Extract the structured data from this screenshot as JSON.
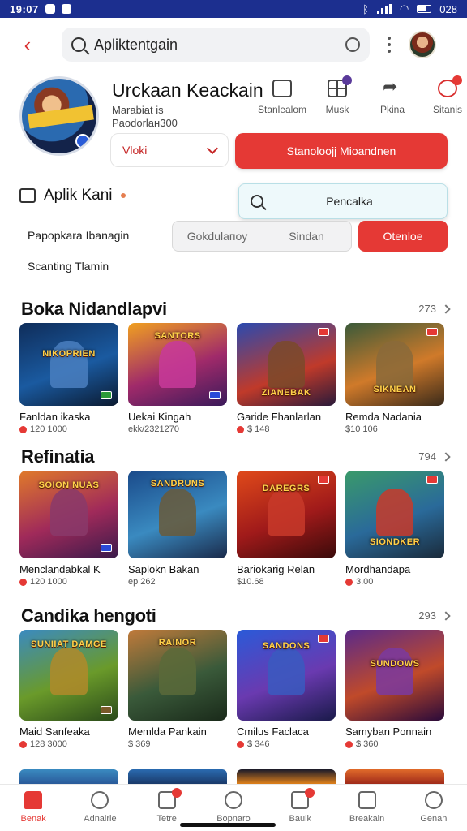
{
  "status_bar": {
    "time": "19:07",
    "battery": "028"
  },
  "topbar": {
    "search_text": "Apliktentgain"
  },
  "profile": {
    "name": "Urckaan Keackain",
    "sub_line1": "Marabiat is",
    "sub_line2": "Paodorlaн300",
    "actions": [
      {
        "label": "Stanlealom",
        "icon": "chat-icon"
      },
      {
        "label": "Musk",
        "icon": "grid-icon"
      },
      {
        "label": "Pkina",
        "icon": "share-icon"
      },
      {
        "label": "Sitanis",
        "icon": "gear-icon"
      }
    ],
    "select_label": "Vloki",
    "primary_button": "Stanoloojj Mioandnen"
  },
  "apk_section": {
    "title": "Aplik Kani",
    "search_text": "Pencalka"
  },
  "filters": {
    "label": "Papopkara Ibanagin",
    "segments": [
      "Gokdulaпоy",
      "Sindan"
    ],
    "active_button": "Otenloe",
    "sub_label": "Scanting Tlamin"
  },
  "sections": [
    {
      "title": "Boka Nidandlapvi",
      "count": "273",
      "cards": [
        {
          "name": "Fanldan ikaska",
          "meta": "120 1000",
          "badge": "",
          "title_art": "NIKOPRIEN"
        },
        {
          "name": "Uekai Kingah",
          "meta": "ekk/2321270",
          "badge": "",
          "title_art": "SANTORS"
        },
        {
          "name": "Garide Fhanlarlan",
          "meta": "$ 148",
          "badge": "",
          "title_art": "ZIANEBAK"
        },
        {
          "name": "Remda Nadania",
          "meta": "$10 106",
          "badge": "",
          "title_art": "SIKNEAN"
        }
      ]
    },
    {
      "title": "Refinatia",
      "count": "794",
      "cards": [
        {
          "name": "Menclandabkal K",
          "meta": "120 1000",
          "badge": "",
          "title_art": "SOION NUAS"
        },
        {
          "name": "Saplokn Bakan",
          "meta": "ep 262",
          "badge": "",
          "title_art": "SANDRUNS"
        },
        {
          "name": "Bariokarig Relan",
          "meta": "$10.68",
          "badge": "",
          "title_art": "DAREGRS"
        },
        {
          "name": "Mordhandapa",
          "meta": "3.00",
          "badge": "",
          "title_art": "SIONDKER"
        }
      ]
    },
    {
      "title": "Candika hengoti",
      "count": "293",
      "cards": [
        {
          "name": "Maid Sanfeaka",
          "meta": "128 3000",
          "badge": "",
          "title_art": "SUNIIAT DAMGE"
        },
        {
          "name": "Memlda Pankain",
          "meta": "$ 369",
          "badge": "",
          "title_art": "RAINOR"
        },
        {
          "name": "Cmilus Faclaca",
          "meta": "$ 346",
          "badge": "",
          "title_art": "SANDONS"
        },
        {
          "name": "Samyban Ponnain",
          "meta": "$ 360",
          "badge": "",
          "title_art": "SUNDOWS"
        }
      ]
    }
  ],
  "bottom_nav": [
    {
      "label": "Benak",
      "active": true
    },
    {
      "label": "Adnairie",
      "active": false
    },
    {
      "label": "Tetre",
      "active": false
    },
    {
      "label": "Bopnaro",
      "active": false
    },
    {
      "label": "Baulk",
      "active": false
    },
    {
      "label": "Breakain",
      "active": false
    },
    {
      "label": "Genan",
      "active": false
    }
  ],
  "colors": {
    "accent": "#e53935",
    "status_bar": "#1c2f8f"
  }
}
